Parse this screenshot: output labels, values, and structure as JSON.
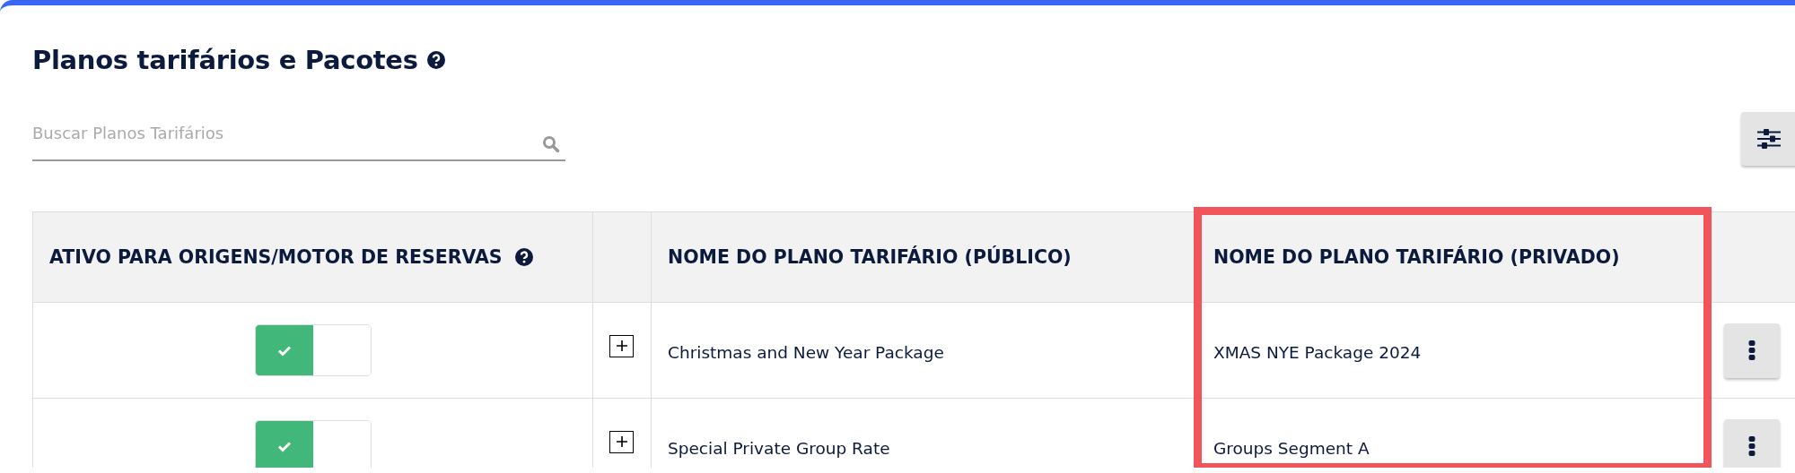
{
  "title": "Planos tarifários e Pacotes",
  "search": {
    "placeholder": "Buscar Planos Tarifários"
  },
  "table": {
    "columns": [
      {
        "label": "ATIVO PARA ORIGENS/MOTOR DE RESERVAS",
        "help": true,
        "highlighted": false
      },
      {
        "help": false,
        "highlighted": false
      },
      {
        "label": "NOME DO PLANO TARIFÁRIO (PÚBLICO)",
        "help": false,
        "highlighted": false
      },
      {
        "label": "NOME DO PLANO TARIFÁRIO (PRIVADO)",
        "help": false,
        "highlighted": true
      },
      {
        "help": false,
        "highlighted": false
      }
    ],
    "rows": [
      {
        "active": true,
        "expanded": false,
        "public_name": "Christmas and New Year Package",
        "private_name": "XMAS NYE Package 2024"
      },
      {
        "active": true,
        "expanded": false,
        "public_name": "Special Private Group Rate",
        "private_name": "Groups Segment A"
      }
    ]
  }
}
